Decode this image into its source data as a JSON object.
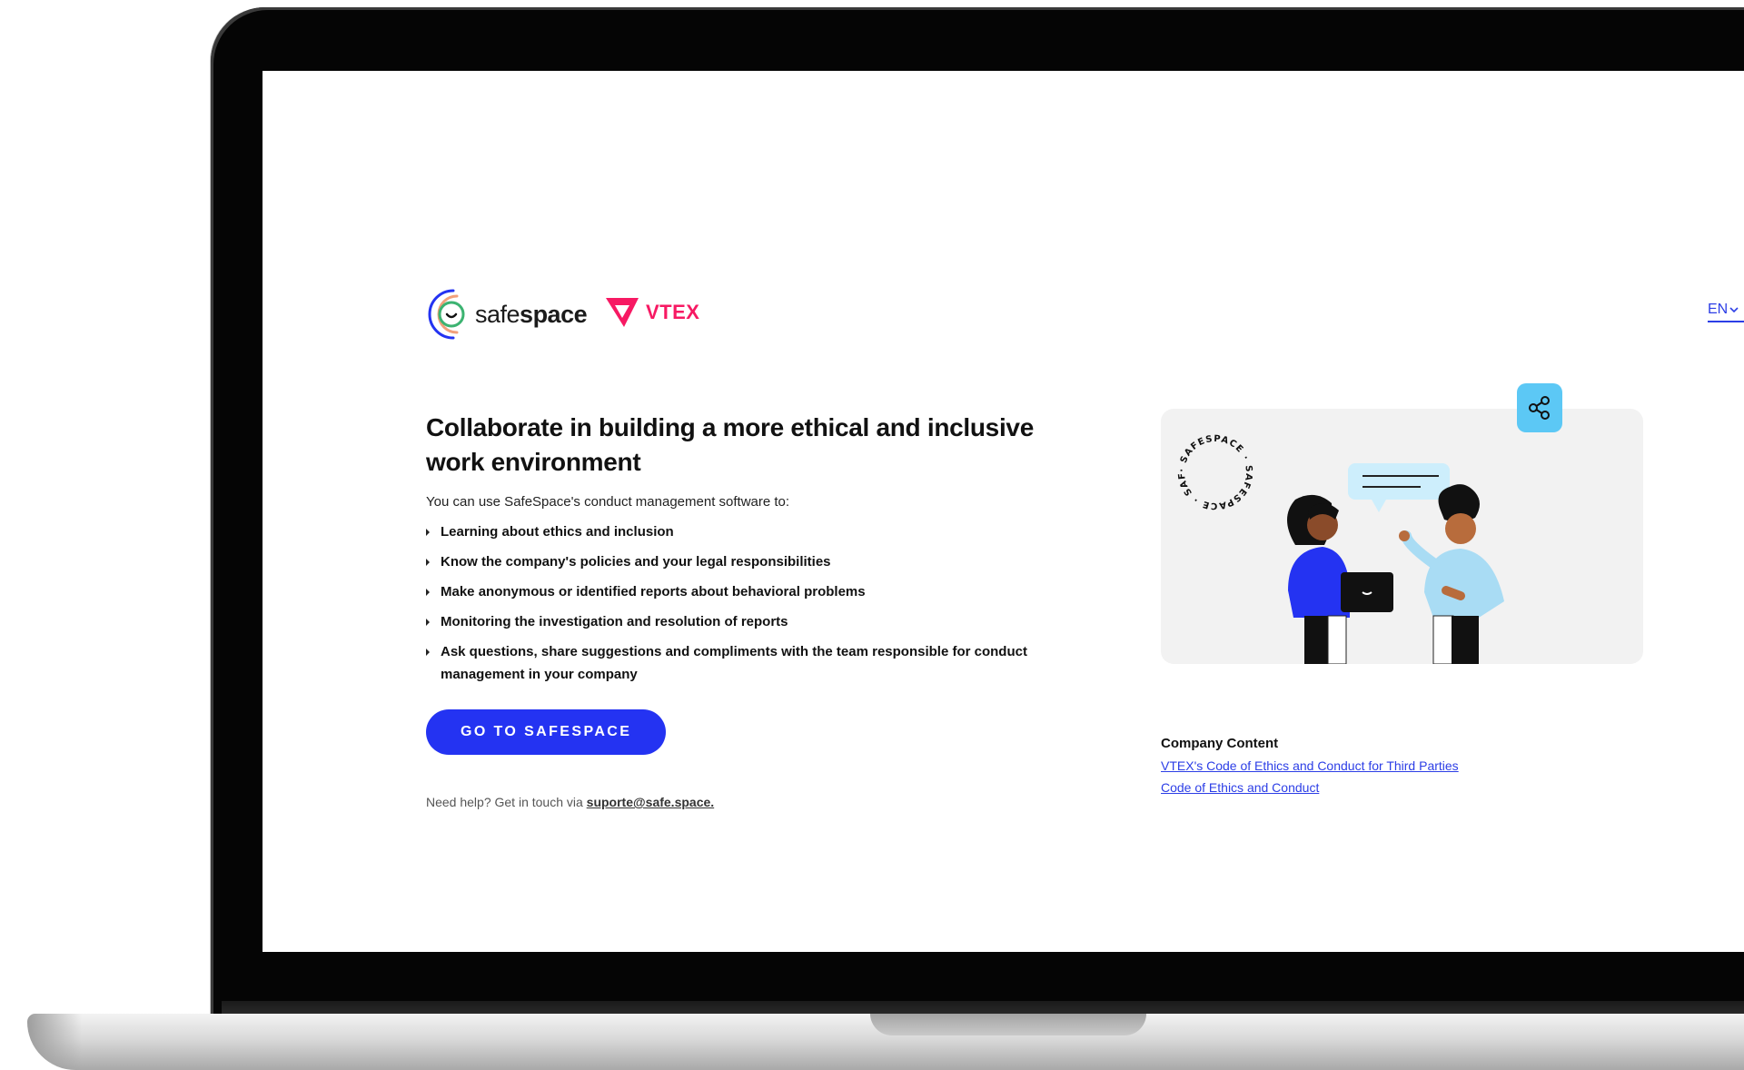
{
  "header": {
    "brand_prefix": "safe",
    "brand_suffix": "space",
    "partner": "VTEX",
    "language": "EN"
  },
  "main": {
    "headline": "Collaborate in building a more ethical and inclusive work environment",
    "intro": "You can use SafeSpace's conduct management software to:",
    "features": [
      "Learning about ethics and inclusion",
      "Know the company's policies and your legal responsibilities",
      "Make anonymous or identified reports about behavioral problems",
      "Monitoring the investigation and resolution of reports",
      "Ask questions, share suggestions and compliments with the team responsible for conduct management in your company"
    ],
    "cta_label": "GO TO SAFESPACE",
    "help_prefix": "Need help? Get in touch via",
    "help_email": "suporte@safe.space."
  },
  "illustration": {
    "badge_text": "· SAFESPACE · SAFESPACE · SAFESPACE"
  },
  "company_content": {
    "title": "Company Content",
    "links": [
      "VTEX's Code of Ethics and Conduct for Third Parties",
      "Code of Ethics and Conduct"
    ]
  },
  "colors": {
    "primary": "#2433f2",
    "link": "#2c3ee6",
    "vtex": "#f71963",
    "share": "#5cc8f5"
  },
  "icons": {
    "share": "share-icon",
    "chevron": "chevron-down-icon"
  }
}
